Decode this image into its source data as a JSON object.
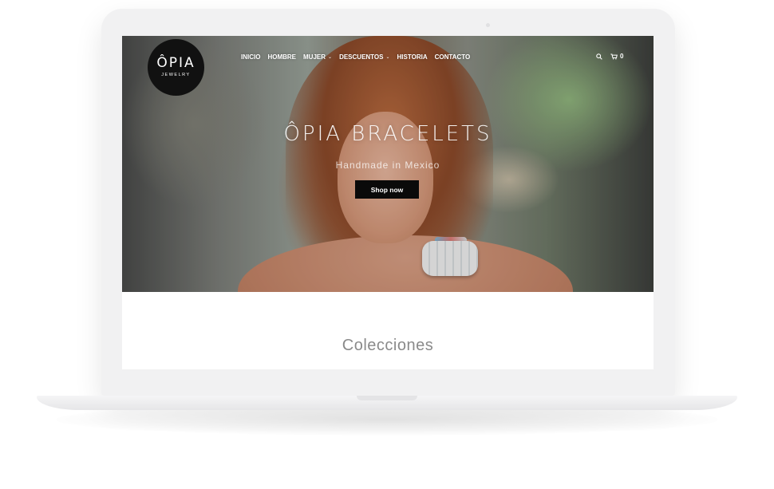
{
  "brand": {
    "logo_text": "ÔPIA",
    "logo_subtext": "JEWELRY"
  },
  "nav": {
    "items": [
      {
        "label": "INICIO",
        "has_dropdown": false
      },
      {
        "label": "HOMBRE",
        "has_dropdown": false
      },
      {
        "label": "MUJER",
        "has_dropdown": true
      },
      {
        "label": "DESCUENTOS",
        "has_dropdown": true
      },
      {
        "label": "HISTORIA",
        "has_dropdown": false
      },
      {
        "label": "CONTACTO",
        "has_dropdown": false
      }
    ],
    "cart_count": "0",
    "search_icon": "search-icon",
    "cart_icon": "cart-icon"
  },
  "hero": {
    "title": "ÔPIA BRACELETS",
    "subtitle": "Handmade in Mexico",
    "cta_label": "Shop now"
  },
  "collections": {
    "title": "Colecciones"
  },
  "colors": {
    "logo_bg": "#111111",
    "cta_bg": "#0a0a0a",
    "section_title": "#8a8a8a",
    "laptop_frame": "#f1f1f2"
  }
}
